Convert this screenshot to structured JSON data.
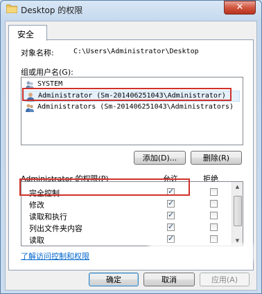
{
  "window": {
    "title": "Desktop 的权限",
    "close_label": "✕"
  },
  "tab": {
    "label": "安全"
  },
  "object": {
    "label": "对象名称:",
    "value": "C:\\Users\\Administrator\\Desktop"
  },
  "groups": {
    "label": "组或用户名(G):",
    "items": [
      {
        "label": "SYSTEM"
      },
      {
        "label": "Administrator (Sm-201406251043\\Administrator)"
      },
      {
        "label": "Administrators (Sm-201406251043\\Administrators)"
      }
    ],
    "selected_index": 1
  },
  "buttons": {
    "add": "添加(D)...",
    "remove": "删除(R)",
    "ok": "确定",
    "cancel": "取消",
    "apply": "应用(A)"
  },
  "permissions": {
    "title": "Administrator 的权限(P)",
    "allow_header": "允许",
    "deny_header": "拒绝",
    "rows": [
      {
        "name": "完全控制",
        "allow": true,
        "deny": false
      },
      {
        "name": "修改",
        "allow": true,
        "deny": false
      },
      {
        "name": "读取和执行",
        "allow": true,
        "deny": false
      },
      {
        "name": "列出文件夹内容",
        "allow": true,
        "deny": false
      },
      {
        "name": "读取",
        "allow": true,
        "deny": false
      }
    ]
  },
  "link": {
    "label": "了解访问控制和权限"
  },
  "colors": {
    "highlight_box": "#d0302a",
    "link": "#0066cc"
  }
}
